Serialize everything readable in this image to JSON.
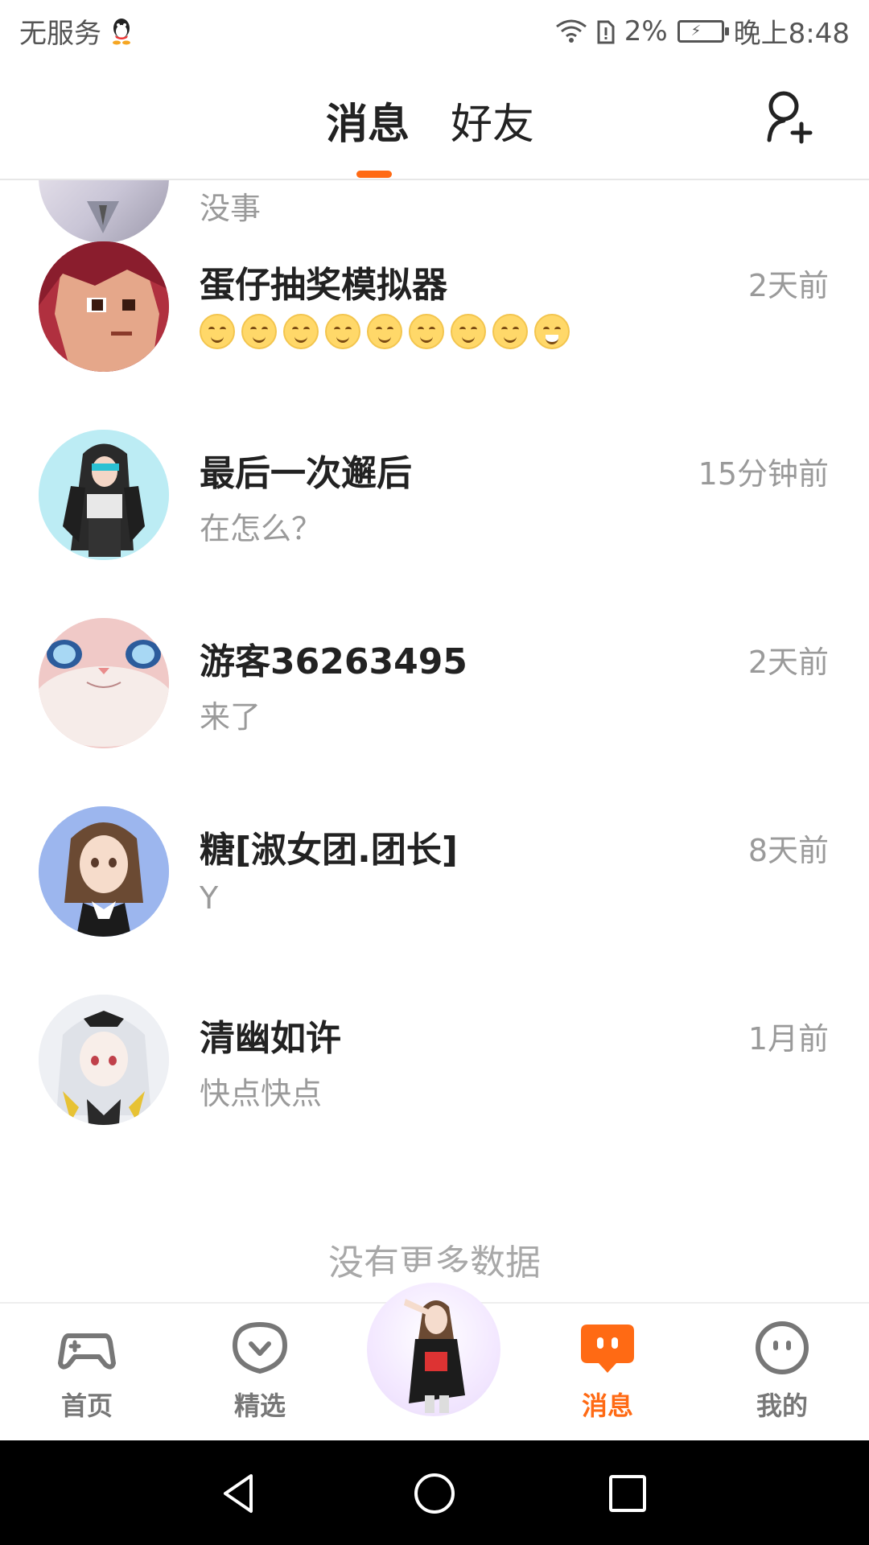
{
  "status_bar": {
    "carrier": "无服务",
    "battery_percent": "2%",
    "time": "晚上8:48"
  },
  "header": {
    "tab_messages": "消息",
    "tab_friends": "好友",
    "active_tab": "消息",
    "accent_color": "#ff6a14"
  },
  "conversations": [
    {
      "name": "",
      "time": "",
      "message": "没事"
    },
    {
      "name": "蛋仔抽奖模拟器",
      "time": "2天前",
      "message": "😊😊😊😊😊😊😊😊😁"
    },
    {
      "name": "最后一次邂后",
      "time": "15分钟前",
      "message": "在怎么？"
    },
    {
      "name": "游客36263495",
      "time": "2天前",
      "message": "来了"
    },
    {
      "name": "糖[淑女团.团长]",
      "time": "8天前",
      "message": "Y"
    },
    {
      "name": "清幽如许",
      "time": "1月前",
      "message": "快点快点"
    }
  ],
  "list_footer": "没有更多数据",
  "bottom_nav": {
    "items": [
      {
        "label": "首页",
        "icon": "gamepad-icon"
      },
      {
        "label": "精选",
        "icon": "heart-chat-icon"
      },
      {
        "label": "消息",
        "icon": "message-bubble-icon",
        "active": true
      },
      {
        "label": "我的",
        "icon": "face-icon"
      }
    ]
  }
}
